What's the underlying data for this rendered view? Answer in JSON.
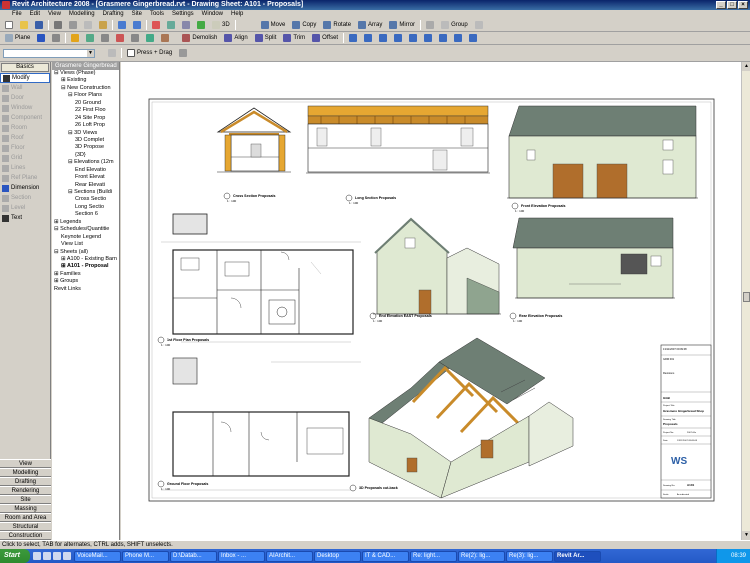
{
  "window": {
    "title": "Revit Architecture 2008 - [Grasmere Gingerbread.rvt - Drawing Sheet: A101 - Proposals]"
  },
  "menu": [
    "File",
    "Edit",
    "View",
    "Modelling",
    "Drafting",
    "Site",
    "Tools",
    "Settings",
    "Window",
    "Help"
  ],
  "toolbar1": {
    "view_3d": "3D"
  },
  "toolbar2": {
    "plane": "Plane"
  },
  "edit_tools": [
    "Move",
    "Copy",
    "Rotate",
    "Array",
    "Mirror"
  ],
  "group_label": "Group",
  "modify_tools": [
    "Demolish",
    "Align",
    "Split",
    "Trim",
    "Offset"
  ],
  "press_drag": "Press + Drag",
  "design_bar": {
    "tab": "Basics",
    "tools": [
      {
        "label": "Modify",
        "enabled": true,
        "selected": true,
        "icon": "arrow-icon"
      },
      {
        "label": "Wall",
        "enabled": false,
        "icon": "wall-icon"
      },
      {
        "label": "Door",
        "enabled": false,
        "icon": "door-icon"
      },
      {
        "label": "Window",
        "enabled": false,
        "icon": "window-icon"
      },
      {
        "label": "Component",
        "enabled": false,
        "icon": "component-icon"
      },
      {
        "label": "Room",
        "enabled": false,
        "icon": "room-icon"
      },
      {
        "label": "Roof",
        "enabled": false,
        "icon": "roof-icon"
      },
      {
        "label": "Floor",
        "enabled": false,
        "icon": "floor-icon"
      },
      {
        "label": "Grid",
        "enabled": false,
        "icon": "grid-icon"
      },
      {
        "label": "Lines",
        "enabled": false,
        "icon": "lines-icon"
      },
      {
        "label": "Ref Plane",
        "enabled": false,
        "icon": "ref-plane-icon"
      },
      {
        "label": "Dimension",
        "enabled": true,
        "icon": "dimension-icon"
      },
      {
        "label": "Section",
        "enabled": false,
        "icon": "section-icon"
      },
      {
        "label": "Level",
        "enabled": false,
        "icon": "level-icon"
      },
      {
        "label": "Text",
        "enabled": true,
        "icon": "text-icon"
      }
    ],
    "bottom_tabs": [
      "View",
      "Modelling",
      "Drafting",
      "Rendering",
      "Site",
      "Massing",
      "Room and Area",
      "Structural",
      "Construction"
    ]
  },
  "project_browser": {
    "header": "Grasmere Gingerbread",
    "tree": [
      {
        "label": "Views (Phase)",
        "level": 0,
        "toggle": "-"
      },
      {
        "label": "Existing",
        "level": 1,
        "toggle": "+"
      },
      {
        "label": "New Construction",
        "level": 1,
        "toggle": "-"
      },
      {
        "label": "Floor Plans",
        "level": 2,
        "toggle": "-"
      },
      {
        "label": "20 Ground",
        "level": 3,
        "toggle": ""
      },
      {
        "label": "22 First Floo",
        "level": 3,
        "toggle": ""
      },
      {
        "label": "24 Site Prop",
        "level": 3,
        "toggle": ""
      },
      {
        "label": "26 Loft Prop",
        "level": 3,
        "toggle": ""
      },
      {
        "label": "3D Views",
        "level": 2,
        "toggle": "-"
      },
      {
        "label": "3D Complet",
        "level": 3,
        "toggle": ""
      },
      {
        "label": "3D Propose",
        "level": 3,
        "toggle": ""
      },
      {
        "label": "{3D}",
        "level": 3,
        "toggle": ""
      },
      {
        "label": "Elevations (12m",
        "level": 2,
        "toggle": "-"
      },
      {
        "label": "End Elevatio",
        "level": 3,
        "toggle": ""
      },
      {
        "label": "Front Elevat",
        "level": 3,
        "toggle": ""
      },
      {
        "label": "Rear Elevati",
        "level": 3,
        "toggle": ""
      },
      {
        "label": "Sections (Buildi",
        "level": 2,
        "toggle": "-"
      },
      {
        "label": "Cross Sectio",
        "level": 3,
        "toggle": ""
      },
      {
        "label": "Long Sectio",
        "level": 3,
        "toggle": ""
      },
      {
        "label": "Section 6",
        "level": 3,
        "toggle": ""
      },
      {
        "label": "Legends",
        "level": 0,
        "toggle": "+"
      },
      {
        "label": "Schedules/Quantitie",
        "level": 0,
        "toggle": "-"
      },
      {
        "label": "Keynote Legend",
        "level": 1,
        "toggle": ""
      },
      {
        "label": "View List",
        "level": 1,
        "toggle": ""
      },
      {
        "label": "Sheets (all)",
        "level": 0,
        "toggle": "-"
      },
      {
        "label": "A100 - Existing Barn",
        "level": 1,
        "toggle": "+"
      },
      {
        "label": "A101 - Proposal",
        "level": 1,
        "toggle": "+",
        "bold": true
      },
      {
        "label": "Families",
        "level": 0,
        "toggle": "+"
      },
      {
        "label": "Groups",
        "level": 0,
        "toggle": "+"
      },
      {
        "label": "Revit Links",
        "level": 0,
        "toggle": ""
      }
    ]
  },
  "sheet": {
    "views": [
      {
        "number": "1",
        "title": "Cross Section Proposals"
      },
      {
        "number": "2",
        "title": "Long Section Proposals"
      },
      {
        "number": "3",
        "title": "Front Elevation Proposals"
      },
      {
        "number": "4",
        "title": "1st Floor Plan Proposals"
      },
      {
        "number": "5",
        "title": "End Elevation EAST Proposals"
      },
      {
        "number": "6",
        "title": "Rear Elevation Proposals"
      },
      {
        "number": "7",
        "title": "Ground Floor Proposals"
      },
      {
        "number": "8",
        "title": "3D Proposals cut-back"
      }
    ],
    "scale": "1 : 100",
    "title_block": {
      "date": "13/11/2007 09:09:08",
      "ref": "GRM 001",
      "revisions_label": "Revisions",
      "client": "GGB",
      "project_label": "Project Title",
      "project": "Grasmere Gingerbread Shop",
      "drawing_label": "Drawing Title",
      "drawing": "Proposals",
      "project_no_label": "Project No.",
      "project_no": "2007-00x",
      "date_label": "Date",
      "date_value": "13/11/2007 09:09:08",
      "logo_initials": "WS",
      "drawing_no_label": "Drawing No.",
      "drawing_no": "A101",
      "scale_label": "Scale",
      "scale_value": "As indicated"
    }
  },
  "status": "Click to select, TAB for alternates, CTRL adds, SHIFT unselects.",
  "taskbar": {
    "start": "Start",
    "tasks": [
      "VoiceMail...",
      "Phone M...",
      "D:\\Datab...",
      "Inbox - ...",
      "AIArchit...",
      "Desktop",
      "IT & CAD...",
      "Re: light...",
      "Re(2): lig...",
      "Re(3): lig...",
      "Revit Ar..."
    ],
    "active_task": 10,
    "clock": "08:39"
  },
  "colors": {
    "title_bg": "#0a246a",
    "taskbar": "#2459c6",
    "start": "#3c9a3c",
    "elev_wall": "#dfe9d2",
    "roof": "#6e7f74",
    "timber": "#c98b2a",
    "section_cut": "#e6a732"
  }
}
